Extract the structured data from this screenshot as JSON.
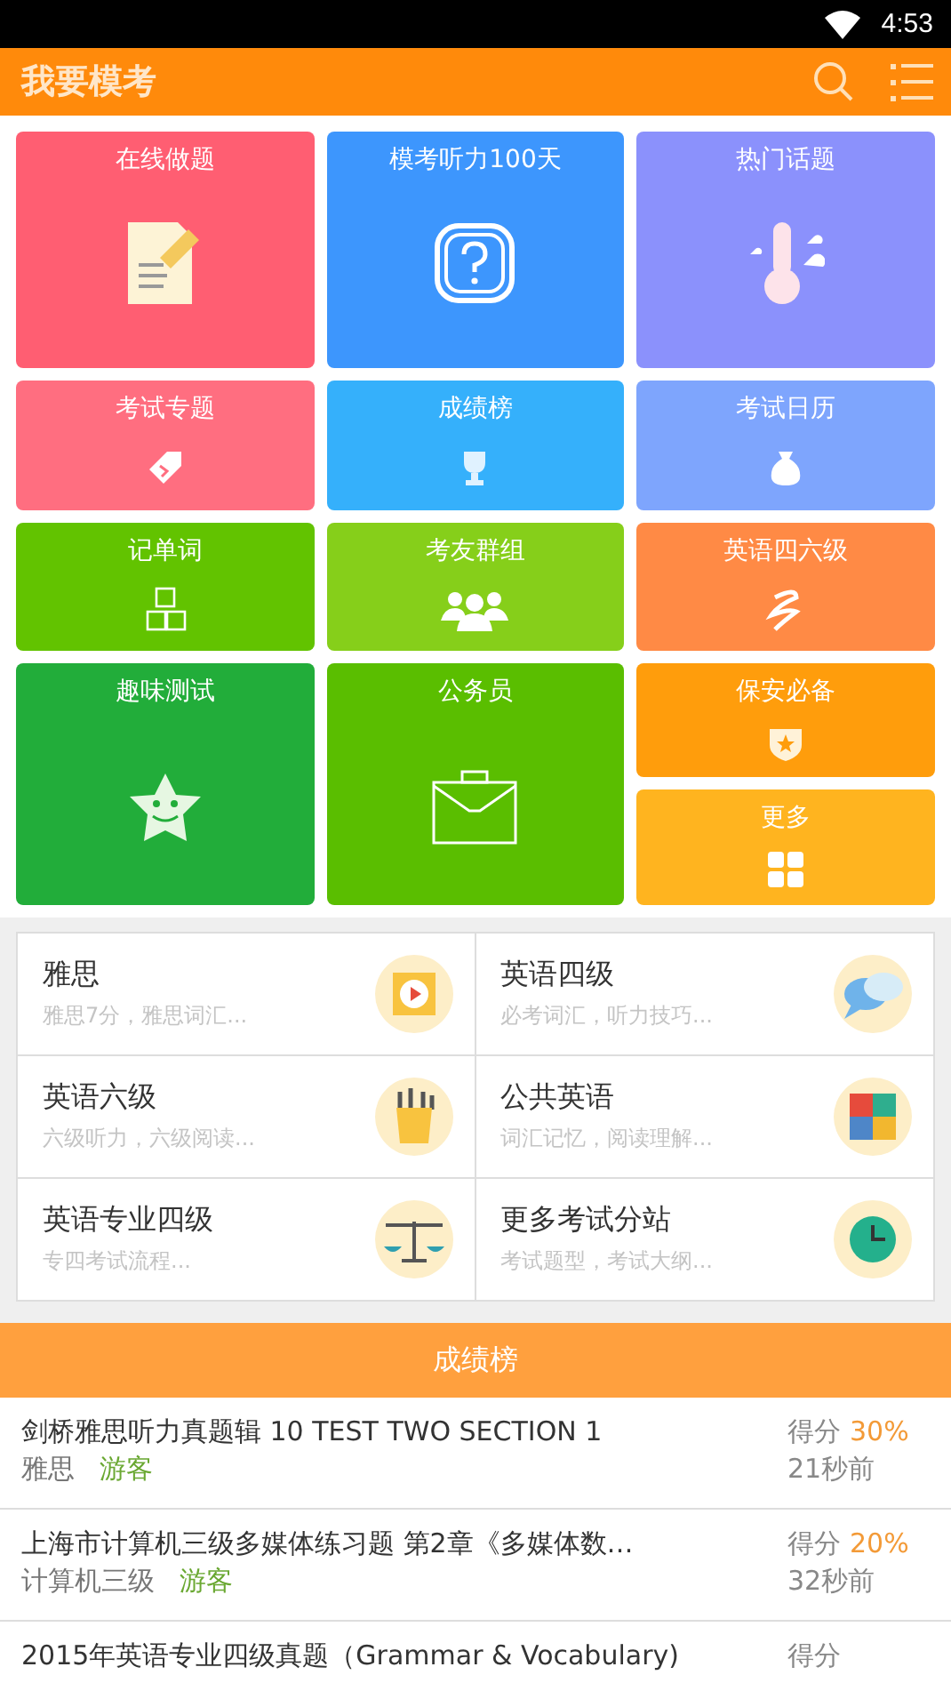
{
  "status_bar": {
    "time": "4:53"
  },
  "header": {
    "title": "我要模考"
  },
  "tiles": [
    {
      "label": "在线做题",
      "color": "#ff5e72",
      "kind": "normal"
    },
    {
      "label": "模考听力100天",
      "color": "#3d96fd",
      "kind": "normal"
    },
    {
      "label": "热门话题",
      "color": "#8b91fc",
      "kind": "normal"
    },
    {
      "label": "考试专题",
      "color": "#ff6e80",
      "kind": "normal"
    },
    {
      "label": "成绩榜",
      "color": "#35b0fb",
      "kind": "normal"
    },
    {
      "label": "考试日历",
      "color": "#7ea5fd",
      "kind": "normal"
    },
    {
      "label": "记单词",
      "color": "#62c300",
      "kind": "normal"
    },
    {
      "label": "考友群组",
      "color": "#86cf1a",
      "kind": "normal"
    },
    {
      "label": "英语四六级",
      "color": "#ff8a45",
      "kind": "normal"
    },
    {
      "label": "趣味测试",
      "color": "#22ad3a",
      "kind": "tall"
    },
    {
      "label": "公务员",
      "color": "#5abe00",
      "kind": "tall"
    },
    {
      "label": "保安必备",
      "color": "#ff9d0c",
      "kind": "normal"
    },
    {
      "label": "更多",
      "color": "#ffb41f",
      "kind": "normal"
    }
  ],
  "exams": [
    {
      "title": "雅思",
      "subtitle": "雅思7分，雅思词汇..."
    },
    {
      "title": "英语四级",
      "subtitle": "必考词汇，听力技巧..."
    },
    {
      "title": "英语六级",
      "subtitle": "六级听力，六级阅读..."
    },
    {
      "title": "公共英语",
      "subtitle": "词汇记忆，阅读理解..."
    },
    {
      "title": "英语专业四级",
      "subtitle": "专四考试流程..."
    },
    {
      "title": "更多考试分站",
      "subtitle": "考试题型，考试大纲..."
    }
  ],
  "ranking": {
    "title": "成绩榜",
    "rows": [
      {
        "title": "剑桥雅思听力真题辑 10 TEST TWO SECTION 1",
        "category": "雅思",
        "user": "游客",
        "score_label": "得分",
        "score": "30%",
        "time": "21秒前"
      },
      {
        "title": "上海市计算机三级多媒体练习题 第2章《多媒体数…",
        "category": "计算机三级",
        "user": "游客",
        "score_label": "得分",
        "score": "20%",
        "time": "32秒前"
      },
      {
        "title": "2015年英语专业四级真题（Grammar & Vocabulary)",
        "score_label": "得分"
      }
    ]
  }
}
